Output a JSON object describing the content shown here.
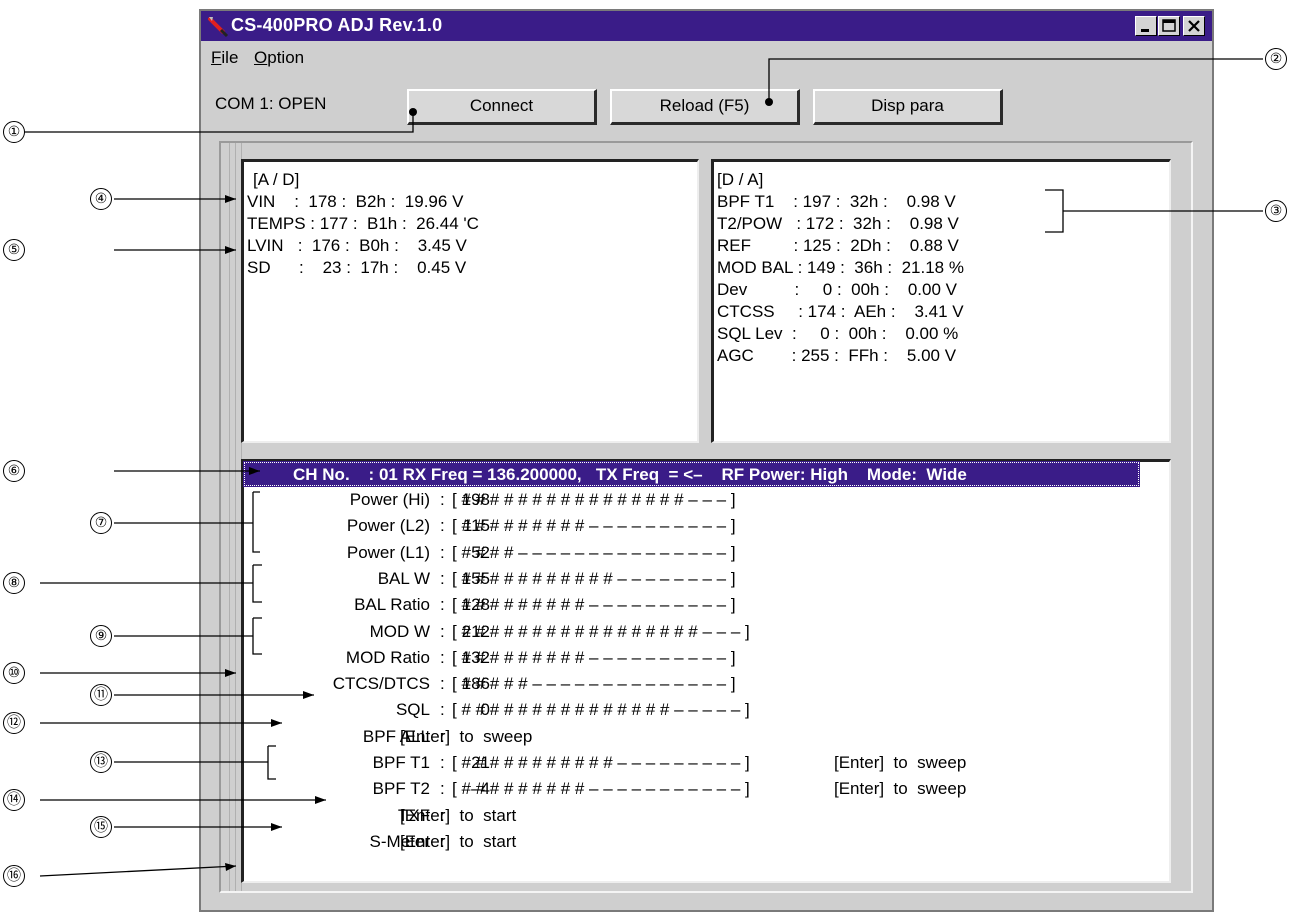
{
  "window": {
    "title": "CS-400PRO ADJ Rev.1.0"
  },
  "menu": {
    "file": "File",
    "option": "Option"
  },
  "toolbar": {
    "status": "COM 1: OPEN",
    "connect_label": "Connect",
    "reload_label": "Reload (F5)",
    "disp_label": "Disp  para"
  },
  "ad_panel": {
    "header": "[A / D]",
    "rows": [
      "VIN    :  178 :  B2h :  19.96 V",
      "TEMPS : 177 :  B1h :  26.44 'C",
      "LVIN   :  176 :  B0h :    3.45 V",
      "SD      :    23 :  17h :    0.45 V"
    ]
  },
  "da_panel": {
    "header": "[D / A]",
    "rows": [
      "BPF T1    : 197 :  32h :    0.98 V",
      "T2/POW   : 172 :  32h :    0.98 V",
      "REF         : 125 :  2Dh :    0.88 V",
      "MOD BAL : 149 :  36h :  21.18 %",
      "Dev          :     0 :  00h :    0.00 V",
      "CTCSS     : 174 :  AEh :    3.41 V",
      "SQL Lev  :     0 :  00h :    0.00 %",
      "AGC        : 255 :  FFh :    5.00 V"
    ]
  },
  "channel_bar": "CH No.    : 01 RX Freq = 136.200000,   TX Freq  = <–    RF Power: High    Mode:  Wide",
  "adjust_rows": [
    {
      "name": "Power (Hi)",
      "value": "198",
      "bar": "[ # # # # # # # # # # # # # # # # – – – ]",
      "extra": ""
    },
    {
      "name": "Power (L2)",
      "value": "115",
      "bar": "[ # # # # # # # # # – – – – – – – – – – ]",
      "extra": ""
    },
    {
      "name": "Power (L1)",
      "value": "52",
      "bar": "[ # # # # – – – – – – – – – – – – – – – ]",
      "extra": ""
    },
    {
      "name": "BAL W",
      "value": "155",
      "bar": "[ # # # # # # # # # # # – – – – – – – – ]",
      "extra": ""
    },
    {
      "name": "BAL Ratio",
      "value": "128",
      "bar": "[ # # # # # # # # # – – – – – – – – – – ]",
      "extra": ""
    },
    {
      "name": "MOD W",
      "value": "212",
      "bar": "[ # # # # # # # # # # # # # # # # # – – – ]",
      "extra": ""
    },
    {
      "name": "MOD Ratio",
      "value": "132",
      "bar": "[ # # # # # # # # # – – – – – – – – – – ]",
      "extra": ""
    },
    {
      "name": "CTCS/DTCS",
      "value": "186",
      "bar": "[ # # # # # – – – – – – – – – – – – – – ]",
      "extra": ""
    },
    {
      "name": "SQL",
      "value": "0",
      "bar": "[ # # # # # # # # # # # # # # # – – – – – ]",
      "extra": ""
    },
    {
      "name": "BPF ALL",
      "value": "",
      "bar": "[Enter]  to  sweep",
      "extra": ""
    },
    {
      "name": "BPF T1",
      "value": "21",
      "bar": "[ # # # # # # # # # # # – – – – – – – – – ]",
      "extra": "[Enter]  to  sweep"
    },
    {
      "name": "BPF T2",
      "value": "–4",
      "bar": "[ # # # # # # # # # – – – – – – – – – – – ]",
      "extra": "[Enter]  to  sweep"
    },
    {
      "name": "TXF",
      "value": "",
      "bar": "[Enter]  to  start",
      "extra": ""
    },
    {
      "name": "S-Meter",
      "value": "",
      "bar": "[Enter]  to  start",
      "extra": ""
    }
  ],
  "callouts": [
    "①",
    "②",
    "③",
    "④",
    "⑤",
    "⑥",
    "⑦",
    "⑧",
    "⑨",
    "⑩",
    "⑪",
    "⑫",
    "⑬",
    "⑭",
    "⑮",
    "⑯"
  ]
}
